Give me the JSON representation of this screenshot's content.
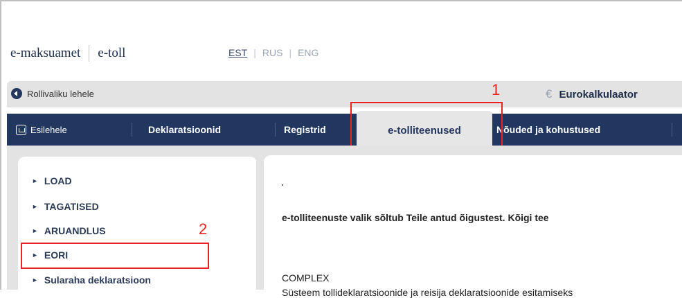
{
  "header": {
    "brand_left": "e-maksuamet",
    "brand_right": "e-toll",
    "languages": [
      "EST",
      "RUS",
      "ENG"
    ],
    "active_language": "EST"
  },
  "topbar": {
    "back_link": "Rollivaliku lehele",
    "euro_calc": "Eurokalkulaator"
  },
  "nav": {
    "home": "Esilehele",
    "items": [
      "Deklaratsioonid",
      "Registrid",
      "e-tolliteenused",
      "Nõuded ja kohustused"
    ],
    "active": "e-tolliteenused"
  },
  "annotations": {
    "one": "1",
    "two": "2",
    "color": "#e8231f"
  },
  "sidebar": {
    "items": [
      "LOAD",
      "TAGATISED",
      "ARUANDLUS",
      "EORI",
      "Sularaha deklaratsioon"
    ]
  },
  "content": {
    "intro": "e-tolliteenuste valik sõltub Teile antud õigustest. Kõigi tee",
    "section_title": "COMPLEX",
    "section_desc": "Süsteem tollideklaratsioonide ja reisija deklaratsioonide esitamiseks"
  },
  "colors": {
    "nav_bg": "#223760",
    "gray_bg": "#e3e3e3",
    "accent_red": "#e8231f"
  }
}
